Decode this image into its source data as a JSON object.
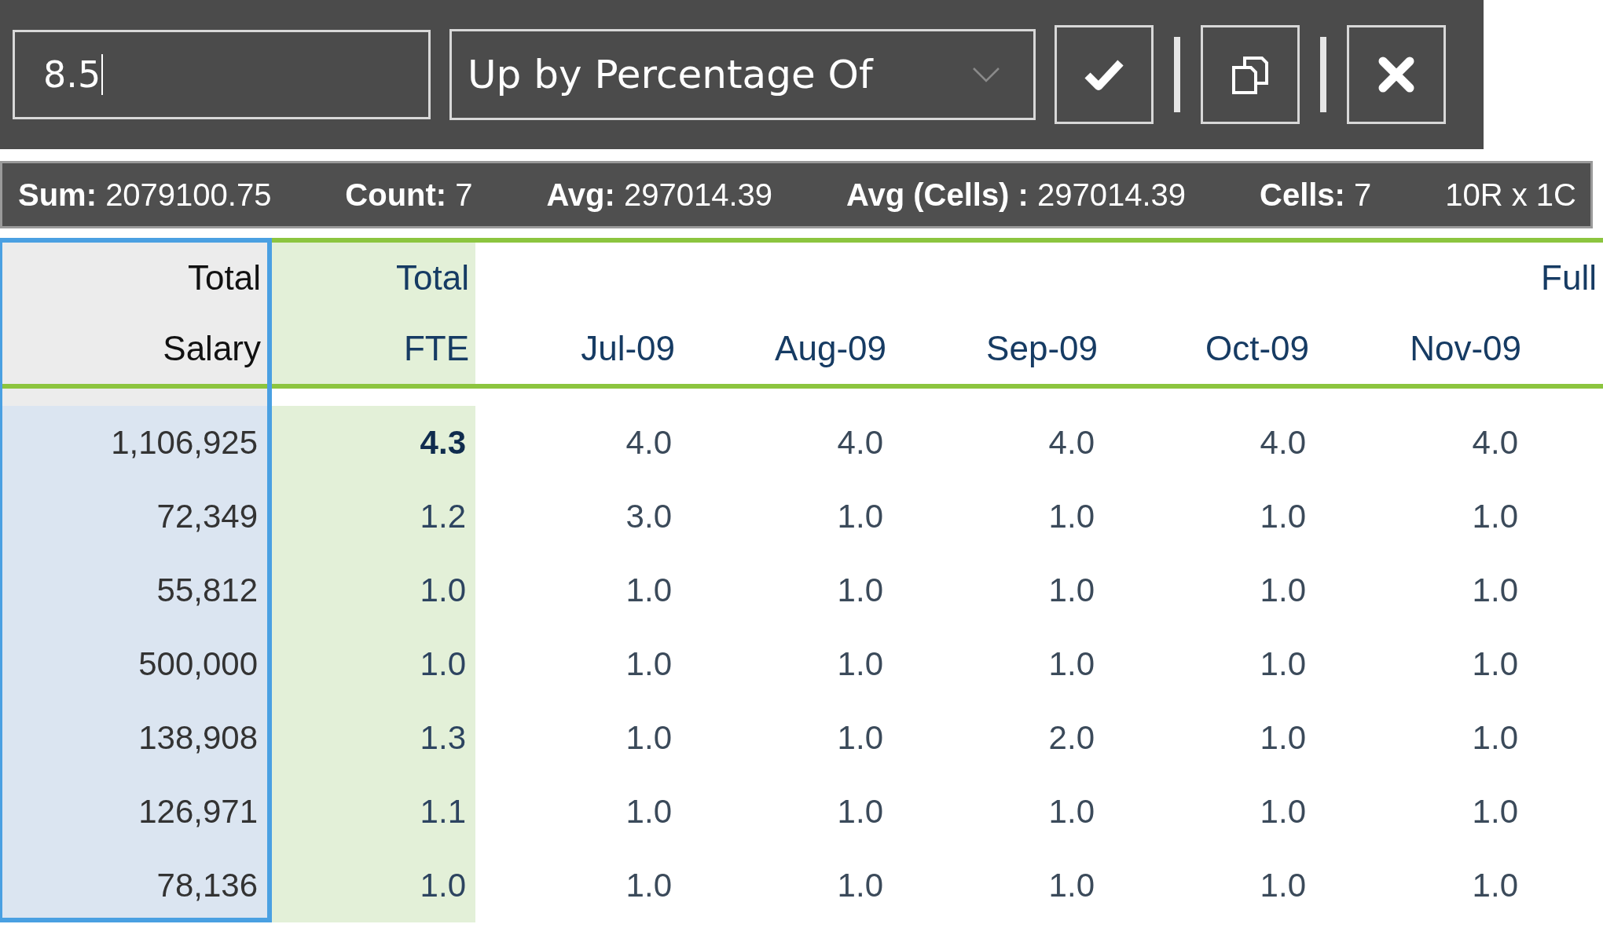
{
  "toolbar": {
    "value_field": {
      "value": "8.5"
    },
    "operation_dropdown": {
      "value": "Up by Percentage Of"
    },
    "buttons": [
      {
        "kind": "apply"
      },
      {
        "kind": "copy"
      },
      {
        "kind": "cancel"
      }
    ]
  },
  "stats_bar": [
    {
      "label": "Sum:",
      "value": "2079100.75"
    },
    {
      "label": "Count:",
      "value": "7"
    },
    {
      "label": "Avg:",
      "value": "297014.39"
    },
    {
      "label": "Avg (Cells) :",
      "value": "297014.39"
    },
    {
      "label": "Cells:",
      "value": "7"
    },
    {
      "value": "10R x 1C"
    }
  ],
  "table": {
    "columns": [
      {
        "kind": "salary",
        "top": "Total",
        "bottom": "Salary",
        "selected": true
      },
      {
        "kind": "fte",
        "top": "Total",
        "bottom": "FTE",
        "selected": false
      },
      {
        "kind": "month",
        "bottom": "Jul-09",
        "selected": false
      },
      {
        "kind": "month",
        "bottom": "Aug-09",
        "selected": false
      },
      {
        "kind": "month",
        "bottom": "Sep-09",
        "selected": false
      },
      {
        "kind": "month",
        "bottom": "Oct-09",
        "selected": false
      },
      {
        "kind": "month",
        "bottom": "Nov-09",
        "selected": false
      },
      {
        "kind": "month",
        "top": "Full",
        "selected": false
      }
    ],
    "rows": [
      {
        "cells": [
          "1,106,925",
          "4.3",
          "4.0",
          "4.0",
          "4.0",
          "4.0",
          "4.0"
        ],
        "fte_bold": true
      },
      {
        "cells": [
          "72,349",
          "1.2",
          "3.0",
          "1.0",
          "1.0",
          "1.0",
          "1.0"
        ],
        "fte_bold": false
      },
      {
        "cells": [
          "55,812",
          "1.0",
          "1.0",
          "1.0",
          "1.0",
          "1.0",
          "1.0"
        ],
        "fte_bold": false
      },
      {
        "cells": [
          "500,000",
          "1.0",
          "1.0",
          "1.0",
          "1.0",
          "1.0",
          "1.0"
        ],
        "fte_bold": false
      },
      {
        "cells": [
          "138,908",
          "1.3",
          "1.0",
          "1.0",
          "2.0",
          "1.0",
          "1.0"
        ],
        "fte_bold": false
      },
      {
        "cells": [
          "126,971",
          "1.1",
          "1.0",
          "1.0",
          "1.0",
          "1.0",
          "1.0"
        ],
        "fte_bold": false
      },
      {
        "cells": [
          "78,136",
          "1.0",
          "1.0",
          "1.0",
          "1.0",
          "1.0",
          "1.0"
        ],
        "fte_bold": false
      }
    ]
  }
}
